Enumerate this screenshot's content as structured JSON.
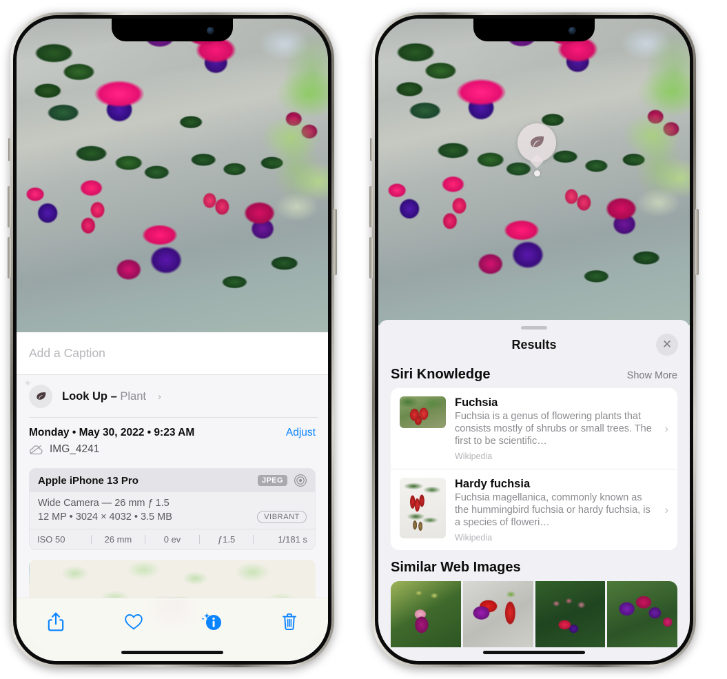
{
  "left_phone": {
    "caption": {
      "placeholder": "Add a Caption",
      "value": ""
    },
    "lookup": {
      "label": "Look Up – ",
      "subject": "Plant",
      "chevron": "›",
      "icon": "leaf-icon",
      "sparkle": "✦"
    },
    "metadata": {
      "date": "Monday • May 30, 2022 • 9:23 AM",
      "adjust_label": "Adjust",
      "filename": "IMG_4241",
      "cloud_icon": "icloud-slash-icon"
    },
    "camera": {
      "model": "Apple iPhone 13 Pro",
      "format_badge": "JPEG",
      "aperture_icon": "aperture-icon",
      "lens": "Wide Camera — 26 mm ƒ 1.5",
      "specs": "12 MP • 3024 × 4032 • 3.5 MB",
      "color_chip": "VIBRANT",
      "exif": [
        "ISO 50",
        "26 mm",
        "0 ev",
        "ƒ1.5",
        "1/181 s"
      ]
    },
    "toolbar": [
      {
        "name": "share-button",
        "icon": "share-icon"
      },
      {
        "name": "favorite-button",
        "icon": "heart-icon"
      },
      {
        "name": "info-button",
        "icon": "info-sparkle-icon"
      },
      {
        "name": "delete-button",
        "icon": "trash-icon"
      }
    ]
  },
  "right_phone": {
    "visual_lookup_badge": {
      "icon": "leaf-icon"
    },
    "results": {
      "title": "Results",
      "close_label": "✕",
      "sections": [
        {
          "title": "Siri Knowledge",
          "action": "Show More",
          "items": [
            {
              "title": "Fuchsia",
              "description": "Fuchsia is a genus of flowering plants that consists mostly of shrubs or small trees. The first to be scientific…",
              "source": "Wikipedia",
              "chevron": "›"
            },
            {
              "title": "Hardy fuchsia",
              "description": "Fuchsia magellanica, commonly known as the hummingbird fuchsia or hardy fuchsia, is a species of floweri…",
              "source": "Wikipedia",
              "chevron": "›"
            }
          ]
        },
        {
          "title": "Similar Web Images",
          "action": "",
          "thumbnails": [
            "web-image-1",
            "web-image-2",
            "web-image-3",
            "web-image-4"
          ]
        }
      ]
    }
  },
  "colors": {
    "accent_blue": "#0a84ff",
    "sheet_bg": "#f1f1f5",
    "card_bg": "#ffffff",
    "secondary_text": "#8b8b90"
  }
}
